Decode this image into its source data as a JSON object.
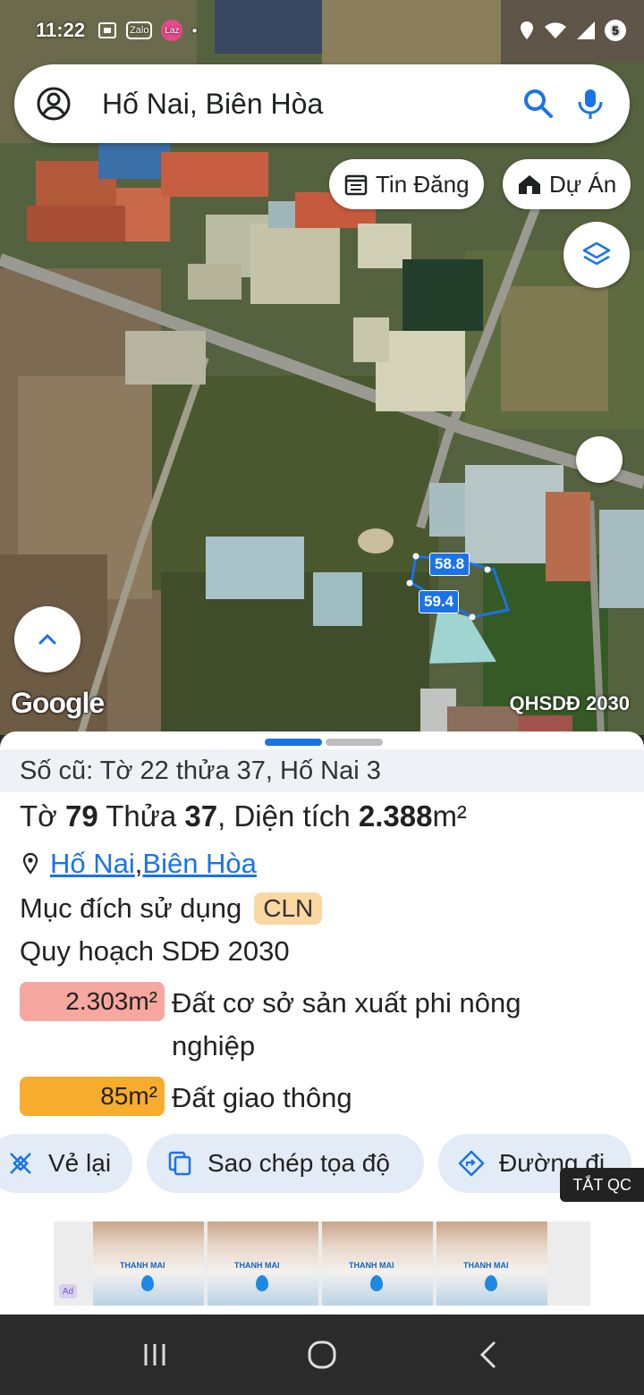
{
  "status_bar": {
    "time": "11:22",
    "app_icons": [
      "zalo",
      "laz"
    ],
    "zalo_label": "Zalo",
    "laz_label": "Laz",
    "battery_badge": "5"
  },
  "search": {
    "value": "Hố Nai, Biên Hòa",
    "left_icon": "account-circle-icon",
    "right_icons": [
      "search-icon",
      "mic-icon"
    ]
  },
  "chips": {
    "listings_label": "Tin Đăng",
    "projects_label": "Dự Án"
  },
  "map": {
    "attribution": "Google",
    "overlay_label": "QHSDĐ 2030",
    "parcel_dim_top": "58.8",
    "parcel_dim_side": "59.4",
    "accent_color": "#1a73e8"
  },
  "sheet": {
    "old_info": "Số cũ: Tờ 22 thửa 37, Hố Nai 3",
    "sheet_prefix": "Tờ ",
    "sheet_no": "79",
    "plot_prefix": " Thửa ",
    "plot_no": "37",
    "area_prefix": ", Diện tích ",
    "area_value": "2.388",
    "area_unit": "m²",
    "addr_ward": "Hố Nai",
    "addr_sep": ", ",
    "addr_city": "Biên Hòa",
    "purpose_label": "Mục đích sử dụng",
    "purpose_code": "CLN",
    "plan_title": "Quy hoạch SDĐ 2030",
    "land_uses": [
      {
        "area": "2.303m²",
        "desc": "Đất cơ sở sản xuất phi nông nghiệp",
        "color": "#f6a79f"
      },
      {
        "area": "85m²",
        "desc": "Đất giao thông",
        "color": "#f7ac2e"
      }
    ],
    "actions": {
      "redraw": "Vẻ lại",
      "copy_coords": "Sao chép tọa độ",
      "directions": "Đường đi"
    },
    "ad_off": "TẮT QC",
    "ad_brand": "THANH MAI",
    "ad_mark": "Ad"
  }
}
